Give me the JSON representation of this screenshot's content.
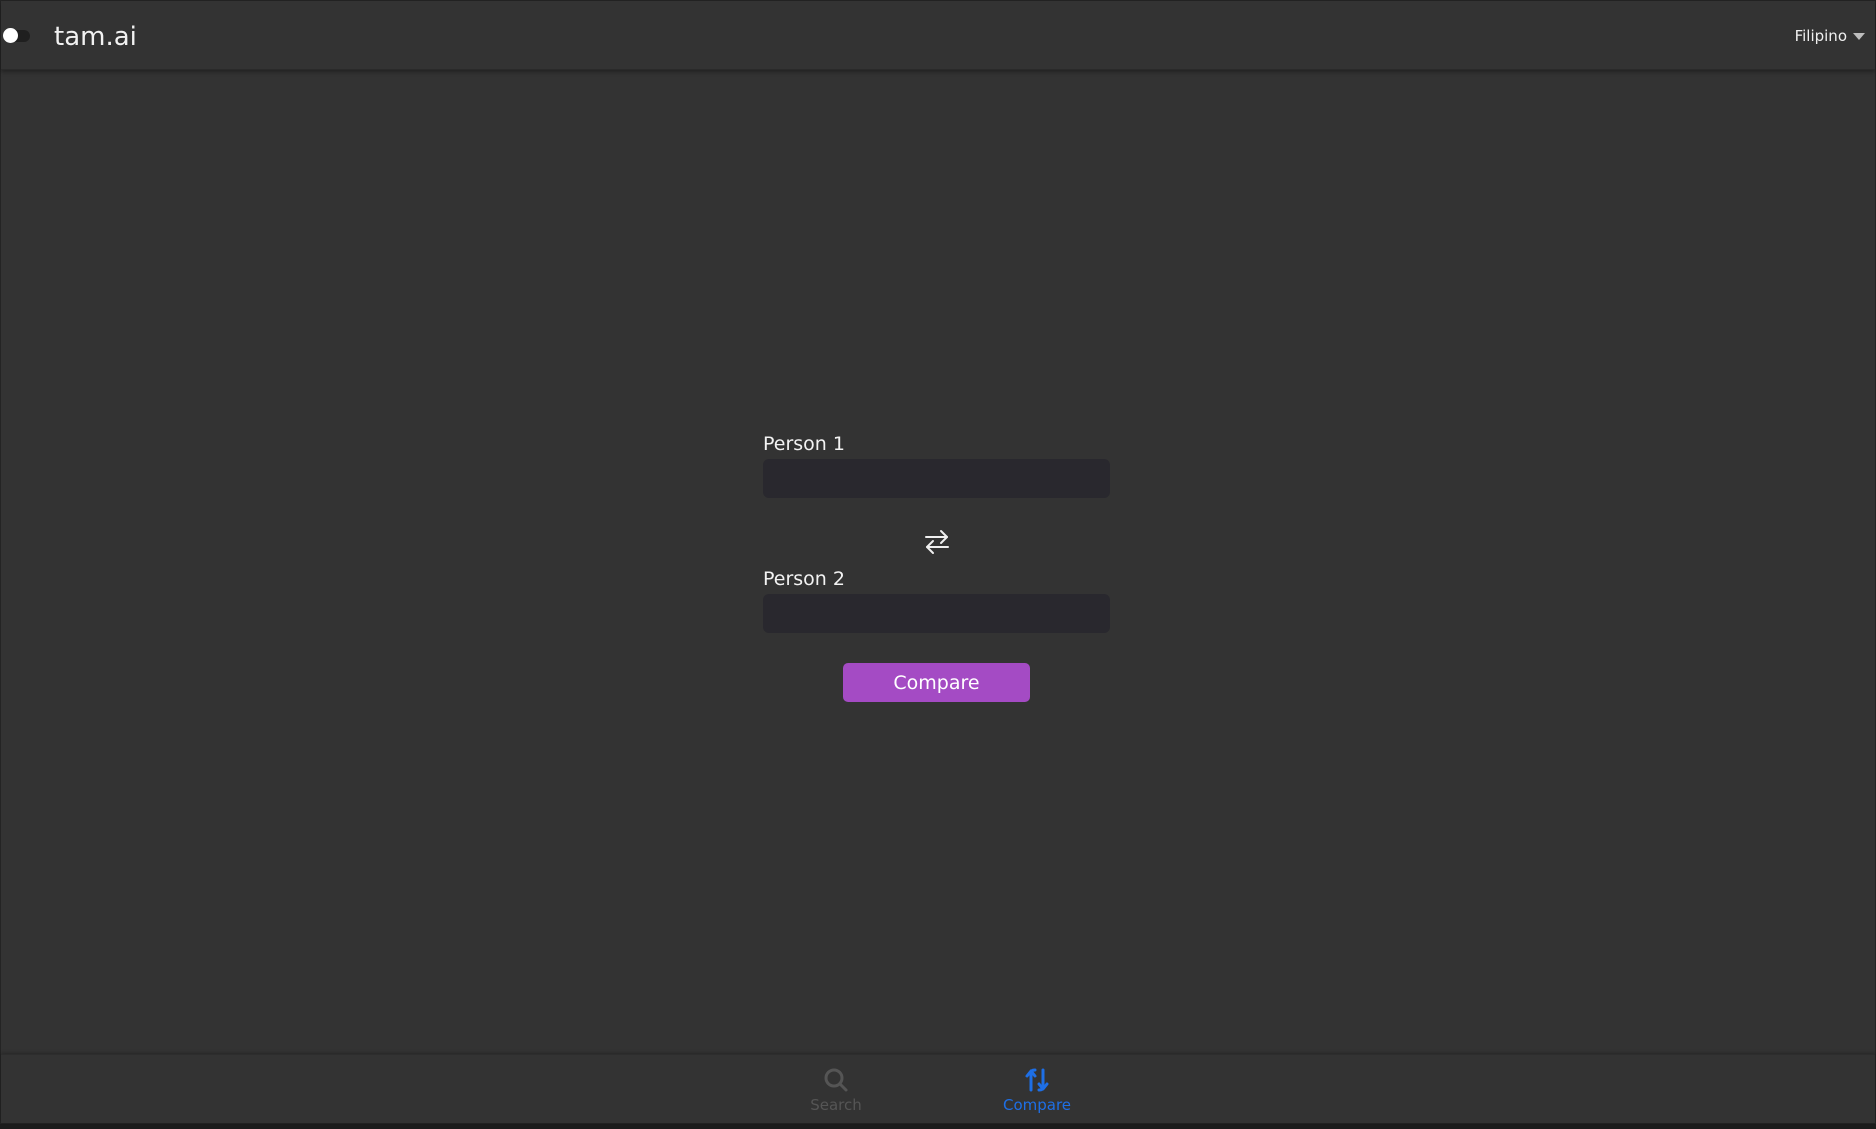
{
  "header": {
    "brand": "tam.ai",
    "language": "Filipino"
  },
  "form": {
    "person1_label": "Person 1",
    "person1_value": "",
    "person2_label": "Person 2",
    "person2_value": "",
    "submit_label": "Compare"
  },
  "bottom_nav": {
    "items": [
      {
        "label": "Search",
        "icon": "search-icon",
        "active": false
      },
      {
        "label": "Compare",
        "icon": "compare-icon",
        "active": true
      }
    ]
  },
  "colors": {
    "background": "#333333",
    "accent": "#a44bc4",
    "nav_active": "#1e6fe6",
    "nav_inactive": "#555555",
    "input_bg": "#29282e"
  }
}
